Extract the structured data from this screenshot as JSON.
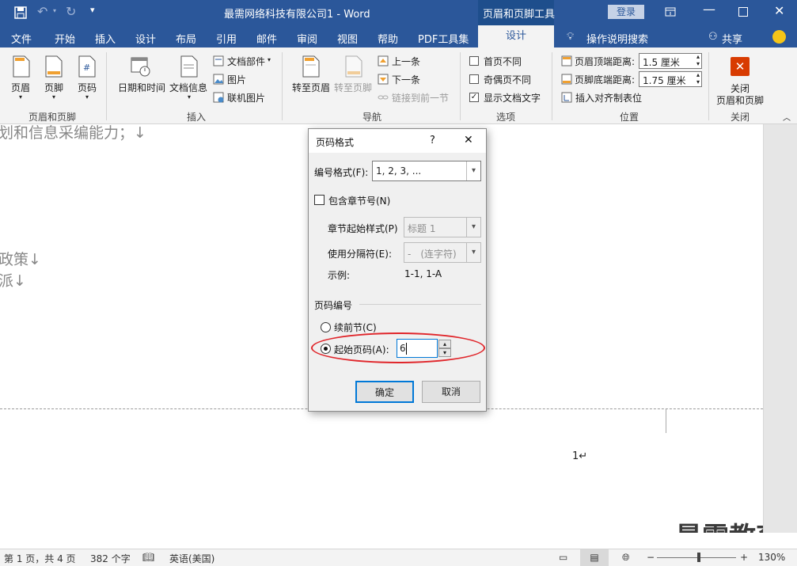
{
  "title_bar": {
    "doc_title": "最需网络科技有限公司1",
    "sep": " - ",
    "app": "Word",
    "context_tab": "页眉和页脚工具",
    "login": "登录"
  },
  "tabs": [
    "文件",
    "开始",
    "插入",
    "设计",
    "布局",
    "引用",
    "邮件",
    "审阅",
    "视图",
    "帮助",
    "PDF工具集",
    "设计"
  ],
  "tell_me": "操作说明搜索",
  "share": "共享",
  "ribbon": {
    "hf_group": {
      "label": "页眉和页脚",
      "header": "页眉",
      "footer": "页脚",
      "page_number": "页码"
    },
    "insert_group": {
      "label": "插入",
      "date_time": "日期和时间",
      "doc_info": "文档信息",
      "doc_parts": "文档部件",
      "picture": "图片",
      "online_picture": "联机图片"
    },
    "nav_group": {
      "label": "导航",
      "goto_header": "转至页眉",
      "goto_footer": "转至页脚",
      "previous": "上一条",
      "next": "下一条",
      "link_previous": "链接到前一节"
    },
    "options_group": {
      "label": "选项",
      "diff_first": "首页不同",
      "diff_odd_even": "奇偶页不同",
      "show_doc_text": "显示文档文字"
    },
    "position_group": {
      "label": "位置",
      "header_top": "页眉顶端距离:",
      "header_top_value": "1.5 厘米",
      "footer_bottom": "页脚底端距离:",
      "footer_bottom_value": "1.75 厘米",
      "insert_align_tab": "插入对齐制表位"
    },
    "close_group": {
      "label": "关闭",
      "close_line1": "关闭",
      "close_line2": "页眉和页脚"
    }
  },
  "document": {
    "line1": "划和信息采编能力；↓",
    "line2": "政策↓",
    "line3": "派↓",
    "footer_page_number": "1↵"
  },
  "dialog": {
    "title": "页码格式",
    "help": "?",
    "close": "✕",
    "number_format_label": "编号格式(F):",
    "number_format_value": "1, 2, 3, ...",
    "include_chapter": "包含章节号(N)",
    "chapter_style_label": "章节起始样式(P)",
    "chapter_style_value": "标题 1",
    "separator_label": "使用分隔符(E):",
    "separator_value": "-　(连字符)",
    "example_label": "示例:",
    "example_value": "1-1, 1-A",
    "page_numbering_label": "页码编号",
    "continue_prev": "续前节(C)",
    "start_at": "起始页码(A):",
    "start_at_value": "6",
    "ok": "确定",
    "cancel": "取消"
  },
  "status_bar": {
    "page": "第 1 页，共 4 页",
    "words": "382 个字",
    "language": "英语(美国)",
    "zoom": "130%"
  },
  "watermark": "最需教育",
  "colors": {
    "brand": "#2b579a",
    "highlight": "#e0262b",
    "focus": "#0078d7"
  }
}
